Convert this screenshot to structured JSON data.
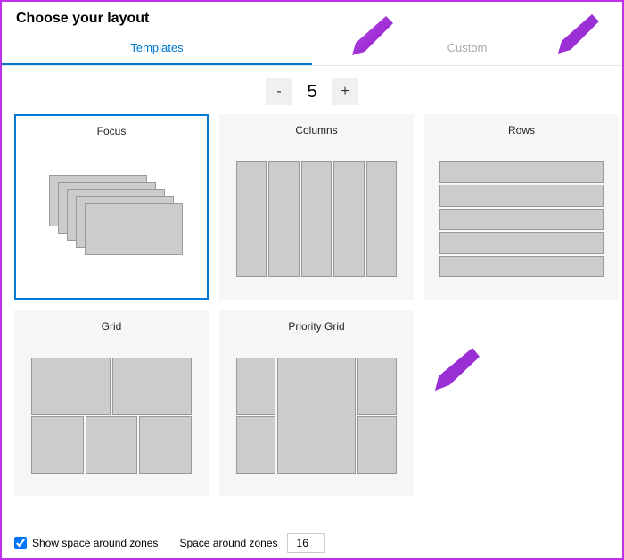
{
  "title": "Choose your layout",
  "tabs": {
    "templates": "Templates",
    "custom": "Custom"
  },
  "stepper": {
    "minus": "-",
    "value": "5",
    "plus": "+"
  },
  "templates": {
    "focus": "Focus",
    "columns": "Columns",
    "rows": "Rows",
    "grid": "Grid",
    "priority_grid": "Priority Grid"
  },
  "footer": {
    "show_space_label": "Show space around zones",
    "space_label": "Space around zones",
    "space_value": "16"
  }
}
